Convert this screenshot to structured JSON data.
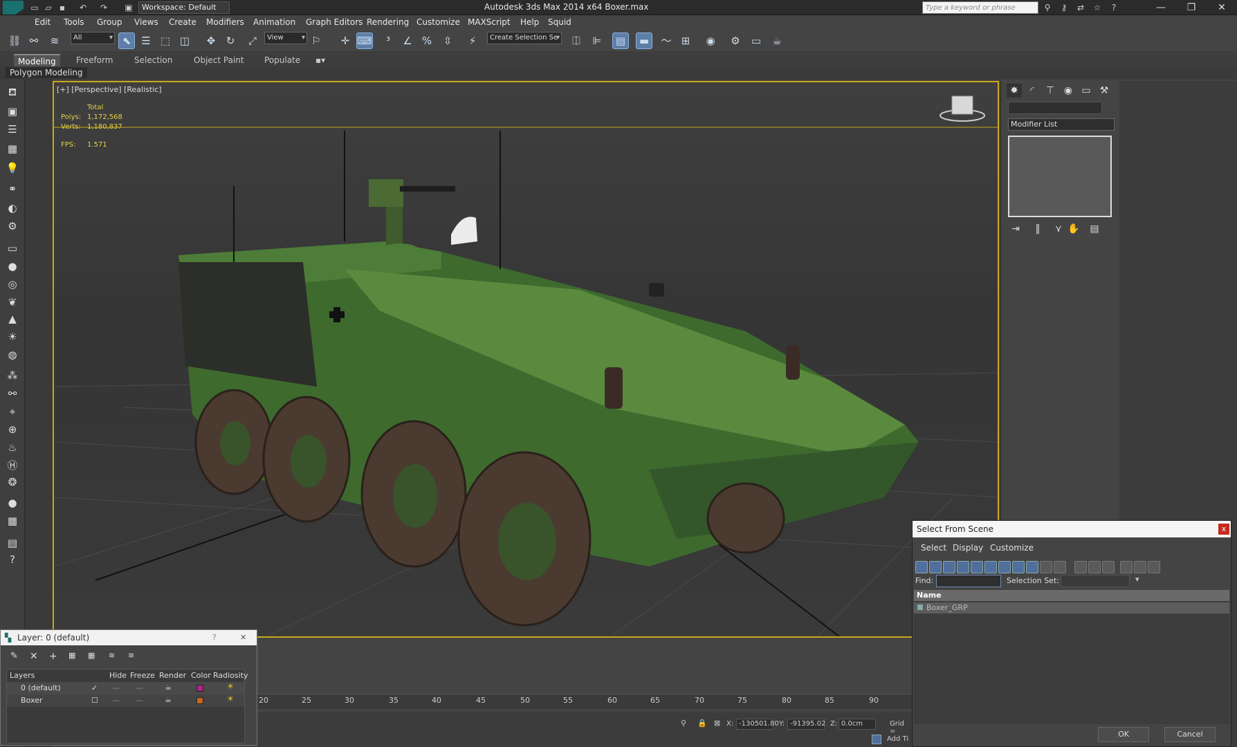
{
  "titlebar": {
    "workspace": "Workspace: Default",
    "app_title": "Autodesk 3ds Max  2014 x64     Boxer.max",
    "search_placeholder": "Type a keyword or phrase",
    "min": "—",
    "max": "❐",
    "close": "✕"
  },
  "menu": [
    "Edit",
    "Tools",
    "Group",
    "Views",
    "Create",
    "Modifiers",
    "Animation",
    "Graph Editors",
    "Rendering",
    "Customize",
    "MAXScript",
    "Help",
    "Squid"
  ],
  "toolbar": {
    "filter_value": "All",
    "ref_coord_value": "View",
    "selection_set_placeholder": "Create Selection Se"
  },
  "ribbon": {
    "tabs": [
      "Modeling",
      "Freeform",
      "Selection",
      "Object Paint",
      "Populate"
    ],
    "panel": "Polygon Modeling"
  },
  "viewport": {
    "label": "[+] [Perspective] [Realistic]",
    "stats": {
      "total_label": "Total",
      "polys_label": "Polys:",
      "polys": "1,172,568",
      "verts_label": "Verts:",
      "verts": "1,180,837",
      "fps_label": "FPS:",
      "fps": "1.571"
    }
  },
  "cmdpanel": {
    "modifier_list": "Modifier List"
  },
  "layer_dialog": {
    "title": "Layer: 0 (default)",
    "help": "?",
    "close": "✕",
    "columns": [
      "Layers",
      "Hide",
      "Freeze",
      "Render",
      "Color",
      "Radiosity"
    ],
    "rows": [
      {
        "name": "0 (default)",
        "color": "#b0208a",
        "checked": "✓"
      },
      {
        "name": "Boxer",
        "color": "#c8641e",
        "checked": "☐"
      }
    ]
  },
  "timeline": {
    "ticks": [
      "20",
      "25",
      "30",
      "35",
      "40",
      "45",
      "50",
      "55",
      "60",
      "65",
      "70",
      "75",
      "80",
      "85",
      "90"
    ]
  },
  "status": {
    "x_label": "X:",
    "x": "-130501.80",
    "y_label": "Y:",
    "y": "-91395.02",
    "z_label": "Z:",
    "z": "0.0cm",
    "grid_label": "Grid =",
    "add_time_tag": "Add Ti"
  },
  "select_dialog": {
    "title": "Select From Scene",
    "close": "x",
    "menus": [
      "Select",
      "Display",
      "Customize"
    ],
    "find_label": "Find:",
    "selection_set_label": "Selection Set:",
    "name_header": "Name",
    "items": [
      "Boxer_GRP"
    ],
    "ok": "OK",
    "cancel": "Cancel"
  }
}
